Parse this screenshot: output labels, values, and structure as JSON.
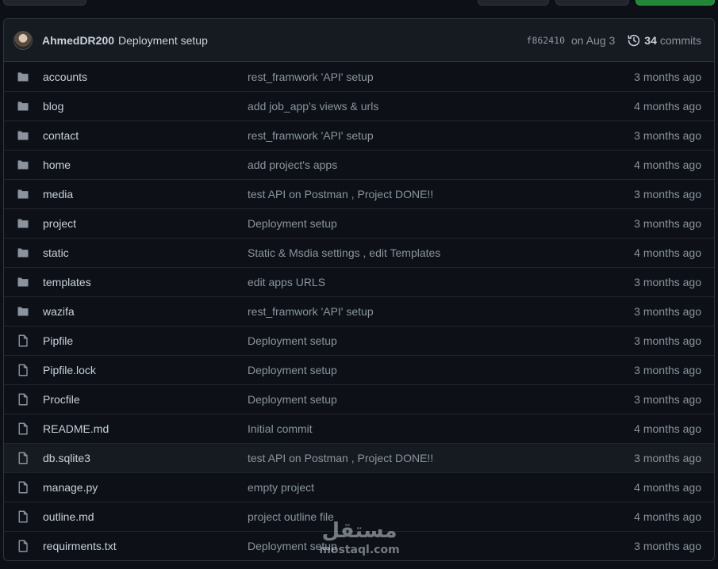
{
  "commit": {
    "author": "AhmedDR200",
    "message": "Deployment setup",
    "sha": "f862410",
    "date": "on Aug 3",
    "commits_count": "34",
    "commits_label": "commits"
  },
  "icons": {
    "folder_color": "#8b949e",
    "file_color": "#8b949e"
  },
  "files": [
    {
      "type": "folder",
      "name": "accounts",
      "message": "rest_framwork 'API' setup",
      "time": "3 months ago"
    },
    {
      "type": "folder",
      "name": "blog",
      "message": "add job_app's views & urls",
      "time": "4 months ago"
    },
    {
      "type": "folder",
      "name": "contact",
      "message": "rest_framwork 'API' setup",
      "time": "3 months ago"
    },
    {
      "type": "folder",
      "name": "home",
      "message": "add project's apps",
      "time": "4 months ago"
    },
    {
      "type": "folder",
      "name": "media",
      "message": "test API on Postman , Project DONE!!",
      "time": "3 months ago"
    },
    {
      "type": "folder",
      "name": "project",
      "message": "Deployment setup",
      "time": "3 months ago"
    },
    {
      "type": "folder",
      "name": "static",
      "message": "Static & Msdia settings , edit Templates",
      "time": "4 months ago"
    },
    {
      "type": "folder",
      "name": "templates",
      "message": "edit apps URLS",
      "time": "3 months ago"
    },
    {
      "type": "folder",
      "name": "wazifa",
      "message": "rest_framwork 'API' setup",
      "time": "3 months ago"
    },
    {
      "type": "file",
      "name": "Pipfile",
      "message": "Deployment setup",
      "time": "3 months ago"
    },
    {
      "type": "file",
      "name": "Pipfile.lock",
      "message": "Deployment setup",
      "time": "3 months ago"
    },
    {
      "type": "file",
      "name": "Procfile",
      "message": "Deployment setup",
      "time": "3 months ago"
    },
    {
      "type": "file",
      "name": "README.md",
      "message": "Initial commit",
      "time": "4 months ago"
    },
    {
      "type": "file",
      "name": "db.sqlite3",
      "message": "test API on Postman , Project DONE!!",
      "time": "3 months ago"
    },
    {
      "type": "file",
      "name": "manage.py",
      "message": "empty project",
      "time": "4 months ago"
    },
    {
      "type": "file",
      "name": "outline.md",
      "message": "project outline file",
      "time": "4 months ago"
    },
    {
      "type": "file",
      "name": "requirments.txt",
      "message": "Deployment setup",
      "time": "3 months ago"
    }
  ],
  "watermark": {
    "arabic": "مستقل",
    "latin": "mostaql.com"
  }
}
